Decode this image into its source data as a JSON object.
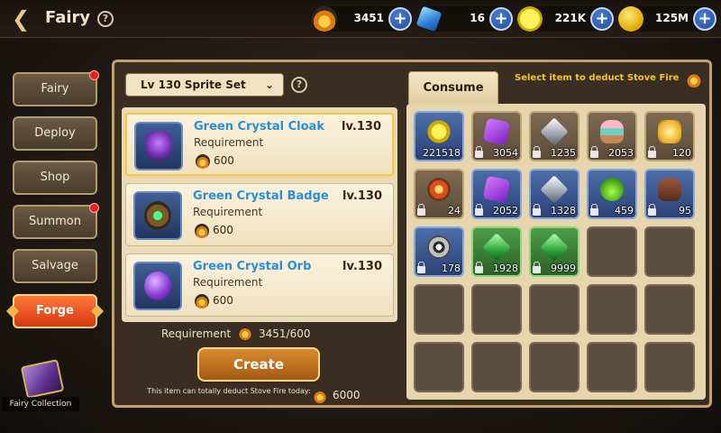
{
  "header": {
    "title": "Fairy",
    "back_icon": "back-arrow-icon",
    "help_icon": "question-icon",
    "currencies": [
      {
        "icon": "stove-fire-icon",
        "value": "3451"
      },
      {
        "icon": "diamond-icon",
        "value": "16"
      },
      {
        "icon": "c-coin-icon",
        "value": "221K"
      },
      {
        "icon": "gold-coin-icon",
        "value": "125M"
      }
    ]
  },
  "sidebar": {
    "tabs": [
      {
        "label": "Fairy",
        "badge": true
      },
      {
        "label": "Deploy",
        "badge": false
      },
      {
        "label": "Shop",
        "badge": false
      },
      {
        "label": "Summon",
        "badge": true
      },
      {
        "label": "Salvage",
        "badge": false
      },
      {
        "label": "Forge",
        "badge": false,
        "active": true
      }
    ],
    "collection_label": "Fairy Collection"
  },
  "forge": {
    "set_selector": "Lv 130 Sprite Set",
    "items": [
      {
        "name": "Green Crystal Cloak",
        "level": "lv.130",
        "req_label": "Requirement",
        "cost": "600",
        "icon": "cloak-icon"
      },
      {
        "name": "Green Crystal Badge",
        "level": "lv.130",
        "req_label": "Requirement",
        "cost": "600",
        "icon": "badge-icon"
      },
      {
        "name": "Green Crystal Orb",
        "level": "lv.130",
        "req_label": "Requirement",
        "cost": "600",
        "icon": "orb-icon"
      }
    ],
    "requirement_label": "Requirement",
    "requirement_value": "3451/600",
    "create_label": "Create",
    "deduct_note": "This item can totally deduct Stove Fire today:",
    "deduct_value": "6000"
  },
  "consume": {
    "tab_label": "Consume item",
    "hint": "Select item to deduct Stove Fire",
    "slots": [
      {
        "icon": "c-coin-icon",
        "qty": "221518",
        "locked": false,
        "style": "blue"
      },
      {
        "icon": "purple-crystal-icon",
        "qty": "3054",
        "locked": true,
        "style": "filled"
      },
      {
        "icon": "silver-crystal-icon",
        "qty": "1235",
        "locked": true,
        "style": "filled"
      },
      {
        "icon": "cake-icon",
        "qty": "2053",
        "locked": true,
        "style": "filled"
      },
      {
        "icon": "lantern-icon",
        "qty": "120",
        "locked": true,
        "style": "filled"
      },
      {
        "icon": "compass-icon",
        "qty": "24",
        "locked": true,
        "style": "filled"
      },
      {
        "icon": "purple-crystal-icon",
        "qty": "2052",
        "locked": true,
        "style": "blue"
      },
      {
        "icon": "silver-crystal-icon",
        "qty": "1328",
        "locked": true,
        "style": "blue"
      },
      {
        "icon": "potion-icon",
        "qty": "459",
        "locked": true,
        "style": "blue"
      },
      {
        "icon": "pot-icon",
        "qty": "95",
        "locked": true,
        "style": "blue"
      },
      {
        "icon": "wheel-icon",
        "qty": "178",
        "locked": true,
        "style": "blue"
      },
      {
        "icon": "green-crystal-icon",
        "qty": "1928",
        "locked": true,
        "style": "green"
      },
      {
        "icon": "green-crystal-icon",
        "qty": "9999",
        "locked": true,
        "style": "green"
      }
    ]
  }
}
